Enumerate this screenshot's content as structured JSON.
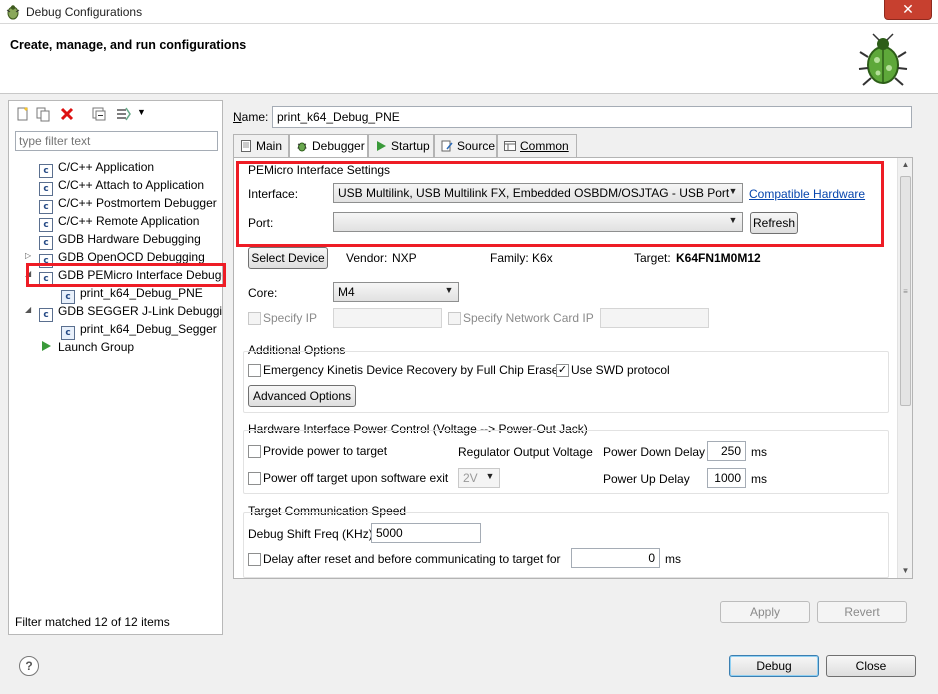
{
  "window": {
    "title": "Debug Configurations",
    "close_glyph": "✕"
  },
  "header": {
    "heading": "Create, manage, and run configurations"
  },
  "left": {
    "filter_placeholder": "type filter text",
    "tree": [
      {
        "label": "C/C++ Application",
        "icon": "c-config-icon"
      },
      {
        "label": "C/C++ Attach to Application",
        "icon": "c-config-icon"
      },
      {
        "label": "C/C++ Postmortem Debugger",
        "icon": "c-config-icon"
      },
      {
        "label": "C/C++ Remote Application",
        "icon": "c-config-icon"
      },
      {
        "label": "GDB Hardware Debugging",
        "icon": "c-config-icon"
      },
      {
        "label": "GDB OpenOCD Debugging",
        "icon": "c-config-icon"
      },
      {
        "label": "GDB PEMicro Interface Debugg",
        "icon": "c-config-icon"
      },
      {
        "label": "print_k64_Debug_PNE",
        "icon": "c-config-icon"
      },
      {
        "label": "GDB SEGGER J-Link Debugging",
        "icon": "c-config-icon"
      },
      {
        "label": "print_k64_Debug_Segger",
        "icon": "c-config-icon"
      },
      {
        "label": "Launch Group",
        "icon": "launch-group-icon"
      }
    ],
    "status": "Filter matched 12 of 12 items"
  },
  "name": {
    "label_prefix": "N",
    "label_rest": "ame:",
    "value": "print_k64_Debug_PNE"
  },
  "tabs": [
    {
      "label": "Main",
      "icon": "main-tab-icon"
    },
    {
      "label": "Debugger",
      "icon": "debugger-tab-icon"
    },
    {
      "label": "Startup",
      "icon": "startup-tab-icon"
    },
    {
      "label": "Source",
      "icon": "source-tab-icon"
    },
    {
      "label": "Common",
      "icon": "common-tab-icon"
    }
  ],
  "pemicro": {
    "group_title": "PEMicro Interface Settings",
    "interface_label": "Interface:",
    "interface_value": "USB Multilink, USB Multilink FX, Embedded OSBDM/OSJTAG - USB Port",
    "compatible_link": "Compatible Hardware",
    "port_label": "Port:",
    "port_value": "",
    "refresh": "Refresh"
  },
  "device": {
    "select_button": "Select Device",
    "vendor_label": "Vendor:",
    "vendor_value": "NXP",
    "family_label": "Family:",
    "family_value": "K6x",
    "target_label": "Target:",
    "target_value": "K64FN1M0M12",
    "core_label": "Core:",
    "core_value": "M4",
    "specify_ip": "Specify IP",
    "specify_network": "Specify Network Card IP"
  },
  "additional": {
    "group_title": "Additional Options",
    "emergency": "Emergency Kinetis Device Recovery by Full Chip Erase",
    "use_swd": "Use SWD protocol",
    "use_swd_checked": "✓",
    "advanced_button": "Advanced Options"
  },
  "power": {
    "group_title": "Hardware Interface Power Control (Voltage --> Power-Out Jack)",
    "provide_power": "Provide power to target",
    "regulator_label": "Regulator Output Voltage",
    "power_down_label": "Power Down Delay",
    "power_down_value": "250",
    "power_down_unit": "ms",
    "power_off": "Power off target upon software exit",
    "voltage_value": "2V",
    "power_up_label": "Power Up Delay",
    "power_up_value": "1000",
    "power_up_unit": "ms"
  },
  "comm": {
    "group_title": "Target Communication Speed",
    "shift_label": "Debug Shift Freq (KHz)",
    "shift_value": "5000",
    "delay_label": "Delay after reset and before communicating to target for",
    "delay_value": "0",
    "delay_unit": "ms"
  },
  "buttons": {
    "apply": "Apply",
    "revert": "Revert",
    "debug": "Debug",
    "close": "Close",
    "help": "?"
  },
  "colors": {
    "highlight": "#ee1c25",
    "link": "#0645ad"
  }
}
